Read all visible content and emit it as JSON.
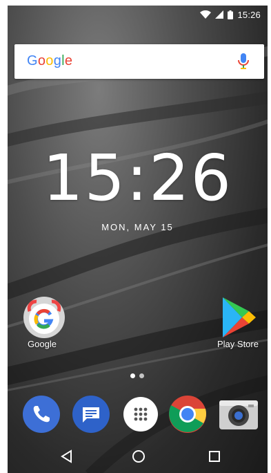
{
  "status_bar": {
    "time": "15:26",
    "icons": [
      "wifi-icon",
      "signal-icon",
      "battery-icon"
    ]
  },
  "search_widget": {
    "logo_letters": [
      "G",
      "o",
      "o",
      "g",
      "l",
      "e"
    ],
    "mic_icon": "mic-icon"
  },
  "clock_widget": {
    "time": "15:26",
    "date": "MON, MAY 15"
  },
  "home_apps": [
    {
      "label": "Google",
      "icon": "google-app-icon"
    },
    {
      "label": "Play Store",
      "icon": "play-store-icon"
    }
  ],
  "page_indicator": {
    "pages": 2,
    "current": 1
  },
  "dock": {
    "apps": [
      {
        "icon": "phone-icon",
        "color": "#3D6FD6"
      },
      {
        "icon": "messages-icon",
        "color": "#2E62C9"
      },
      {
        "icon": "app-drawer-icon",
        "color": "#ffffff"
      },
      {
        "icon": "chrome-icon",
        "color": "#DB4437"
      },
      {
        "icon": "camera-icon",
        "color": "#CFCFCF"
      }
    ]
  },
  "nav_bar": {
    "buttons": [
      "back-icon",
      "home-icon",
      "recents-icon"
    ]
  }
}
